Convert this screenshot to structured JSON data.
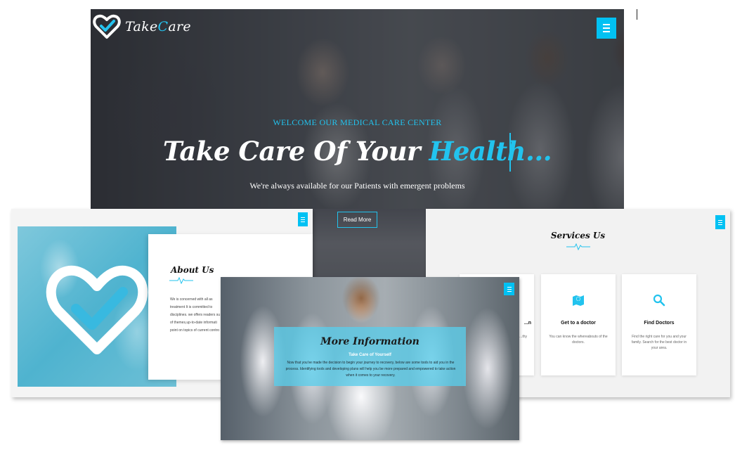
{
  "brand": {
    "logo_prefix": "Take",
    "logo_accent": "C",
    "logo_suffix": "are"
  },
  "colors": {
    "accent": "#22c3ee",
    "menu_button": "#00c1f3"
  },
  "hero": {
    "kicker": "WELCOME OUR MEDICAL CARE CENTER",
    "title_main": "Take Care Of Your ",
    "title_accent": "Health...",
    "subtitle": "We're always available for our Patients with emergent problems",
    "cta": "Read More",
    "menu_icon": "hamburger-icon"
  },
  "about": {
    "title": "About Us",
    "lines": [
      "We is concerned with all as",
      "treatment It is committed to",
      "disciplines. we offers readers su",
      "of themes,up-to-date informati",
      "point on topics of current contro"
    ]
  },
  "services": {
    "title": "Services Us",
    "cards": [
      {
        "name": "...n",
        "desc": "...thy",
        "icon": "partial-icon"
      },
      {
        "name": "Get to a doctor",
        "desc": "You can know the whereabouts of the doctors.",
        "icon": "map-icon"
      },
      {
        "name": "Find Doctors",
        "desc": "Find the right care for you and your family. Search for the best doctor in your area.",
        "icon": "search-icon"
      }
    ]
  },
  "more": {
    "title": "More Information",
    "subtitle": "Take Care of Yourself",
    "text": "Now that you've made the decision to begin your journey to recovery, below are some tools to aid you in the process. Identifying tools and developing plans will help you be more prepared and empowered to take action when it comes to your recovery."
  }
}
